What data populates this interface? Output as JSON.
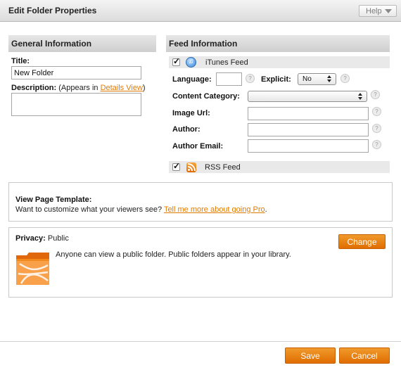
{
  "window": {
    "title": "Edit Folder Properties",
    "help_label": "Help"
  },
  "general": {
    "header": "General Information",
    "title_label": "Title:",
    "title_value": "New Folder",
    "description_label": "Description:",
    "description_note_prefix": "(Appears in ",
    "description_note_link": "Details View",
    "description_note_suffix": ")",
    "description_value": ""
  },
  "feed": {
    "header": "Feed Information",
    "itunes": {
      "label": "iTunes Feed",
      "checked": true
    },
    "language_label": "Language:",
    "language_value": "",
    "explicit_label": "Explicit:",
    "explicit_value": "No",
    "content_category_label": "Content Category:",
    "content_category_value": "",
    "image_url_label": "Image Url:",
    "image_url_value": "",
    "author_label": "Author:",
    "author_value": "",
    "author_email_label": "Author Email:",
    "author_email_value": "",
    "help_glyph": "?",
    "rss": {
      "label": "RSS Feed",
      "checked": true
    }
  },
  "template": {
    "heading": "View Page Template:",
    "text": "Want to customize what your viewers see?",
    "link": "Tell me more about going Pro",
    "suffix": "."
  },
  "privacy": {
    "label": "Privacy:",
    "value": "Public",
    "description": "Anyone can view a public folder. Public folders appear in your library.",
    "change_label": "Change"
  },
  "footer": {
    "save_label": "Save",
    "cancel_label": "Cancel"
  },
  "colors": {
    "accent": "#e47500",
    "link": "#e07b00"
  },
  "icons": {
    "itunes": "itunes-icon",
    "rss": "rss-icon",
    "folder": "folder-icon"
  }
}
